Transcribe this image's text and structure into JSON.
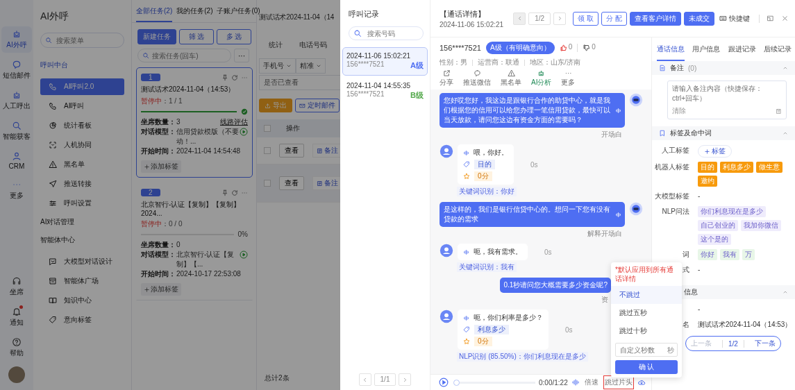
{
  "rail": {
    "items": [
      {
        "label": "AI外呼",
        "selected": true
      },
      {
        "label": "短信邮件",
        "selected": false
      },
      {
        "label": "人工呼出",
        "selected": false
      },
      {
        "label": "智能获客",
        "selected": false
      },
      {
        "label": "CRM",
        "selected": false
      },
      {
        "label": "更多",
        "selected": false
      }
    ],
    "bottom": [
      {
        "label": "坐席",
        "dot": false
      },
      {
        "label": "通知",
        "dot": true
      },
      {
        "label": "帮助",
        "dot": false
      }
    ]
  },
  "nav": {
    "title": "AI外呼",
    "search": {
      "placeholder": "搜索菜单"
    },
    "groups": [
      {
        "title": "呼叫中台",
        "items": [
          {
            "label": "AI呼叫2.0",
            "selected": true
          },
          {
            "label": "AI呼叫",
            "selected": false
          },
          {
            "label": "统计看板",
            "selected": false
          },
          {
            "label": "人机协同",
            "selected": false
          },
          {
            "label": "黑名单",
            "selected": false
          },
          {
            "label": "推送转接",
            "selected": false
          },
          {
            "label": "呼叫设置",
            "selected": false
          }
        ]
      },
      {
        "title": "AI对话管理"
      },
      {
        "title": "智能体中心",
        "items": [
          {
            "label": "大模型对话设计",
            "selected": false
          },
          {
            "label": "智能体广场",
            "selected": false
          },
          {
            "label": "知识中心",
            "selected": false
          },
          {
            "label": "意向标签",
            "selected": false
          }
        ]
      }
    ]
  },
  "tasks": {
    "tabs": [
      {
        "label": "全部任务(2)",
        "selected": true
      },
      {
        "label": "我的任务(2)",
        "selected": false
      },
      {
        "label": "子账户任务(0)",
        "selected": false
      }
    ],
    "buttons": [
      {
        "label": "新建任务",
        "kind": "primary"
      },
      {
        "label": "筛 选",
        "kind": "outline"
      },
      {
        "label": "多 选",
        "kind": "outline"
      }
    ],
    "search": {
      "placeholder": "搜索任务(回车)"
    },
    "more": "···",
    "cards": [
      {
        "number": "1",
        "title": "测试话术2024-11-04（14:53）",
        "status": "暂停中",
        "count": "：1 / 1",
        "level": 1,
        "complete": true,
        "selected": true,
        "fields": [
          {
            "label": "坐席数量：",
            "value": "3"
          },
          {
            "label": "对话模型：",
            "value": "信用贷款模版（不要动！..."
          },
          {
            "label": "开始时间：",
            "value": "2024-11-04 14:54:48"
          }
        ],
        "link": "线路评估",
        "add_tag": "添加标签"
      },
      {
        "number": "2",
        "title": "北京智行-认证【复制】【复制】2024...",
        "status": "暂停中",
        "count": "：0 / 0",
        "level": 0,
        "complete": false,
        "percent": "0%",
        "selected": false,
        "fields": [
          {
            "label": "坐席数量：",
            "value": "0"
          },
          {
            "label": "对话模型：",
            "value": "北京智行-认证【复制】【..."
          },
          {
            "label": "开始时间：",
            "value": "2024-10-17 22:53:08"
          }
        ],
        "add_tag": "添加标签"
      }
    ]
  },
  "main": {
    "title": "测试话术2024-11-04（14",
    "tabs": [
      "统计",
      "电话号码"
    ],
    "filters": [
      "手机号",
      "精准"
    ],
    "viewed_filter": {
      "placeholder": "是否已查看"
    },
    "buttons": [
      {
        "label": "导出",
        "kind": "warning"
      },
      {
        "label": "定时邮件",
        "kind": "outline"
      }
    ],
    "table": {
      "all_checked": false,
      "columns": [
        "操作"
      ],
      "rows": [
        {
          "actions": [
            "查看",
            "备注"
          ],
          "checked": false,
          "selected": false
        },
        {
          "actions": [
            "查看",
            "备注"
          ],
          "checked": false,
          "selected": true
        }
      ]
    },
    "total": "总计2条"
  },
  "records": {
    "title": "呼叫记录",
    "search": {
      "placeholder": "搜索号码"
    },
    "items": [
      {
        "time": "2024-11-06 15:02:21",
        "phone": "156****7521",
        "grade": "A级",
        "color": "#4e6ef2",
        "selected": true
      },
      {
        "time": "2024-11-04 14:55:35",
        "phone": "156****7521",
        "grade": "B级",
        "color": "#52a84a",
        "selected": false
      }
    ],
    "pager": "1/1"
  },
  "detail": {
    "title": "【通话详情】",
    "time": "2024-11-06 15:02:21",
    "pager": "1/2",
    "buttons": [
      {
        "label": "领 取",
        "kind": "outline"
      },
      {
        "label": "分 配",
        "kind": "outline"
      },
      {
        "label": "查看客户详情",
        "kind": "primary"
      },
      {
        "label": "未成交",
        "kind": "primary"
      }
    ],
    "shortcut": "快捷键",
    "phone": "156****7521",
    "intent": "A级（有明确意向）",
    "likes": "0",
    "dislikes": "0",
    "info": [
      "性别：男",
      "运营商：联通",
      "地区：山东/济南"
    ],
    "actions": [
      {
        "label": "分享",
        "selected": false
      },
      {
        "label": "推送微信",
        "selected": false
      },
      {
        "label": "黑名单",
        "selected": false
      },
      {
        "label": "AI分析",
        "selected": true
      },
      {
        "label": "更多",
        "selected": false
      }
    ],
    "messages": [
      {
        "kind": "robot",
        "text": "您好哎您好，我这边是跟银行合作的助贷中心，就是我们根据您的信用可以给您办理一笔信用贷款，最快可以当天放款，请问您这边有资金方面的需要吗？",
        "caption": "开场白"
      },
      {
        "kind": "user",
        "text": "喂，你好。",
        "tags": [
          "目的"
        ],
        "score": "0分",
        "time": "0s",
        "recognition": "关键词识别：你好"
      },
      {
        "kind": "robot",
        "text": "是这样的，我们是银行信贷中心的。想问一下您有没有贷款的需求",
        "caption": "解释开场白"
      },
      {
        "kind": "user",
        "text": "呃，我有需求。",
        "time": "0s",
        "recognition": "关键词识别：我有"
      },
      {
        "kind": "robot_cut",
        "text": "0.1秒请问您大概需要多少资金呢?",
        "caption": "资"
      },
      {
        "kind": "user",
        "text": "呃，你们利率是多少？",
        "tags": [
          "利息多少"
        ],
        "score": "0分",
        "time": "0s",
        "recognition": "NLP识别 (85.50%)：你们利息现在是多少"
      }
    ],
    "player": {
      "time": "0:00/1:22",
      "level": 0,
      "speed": "倍速",
      "skip_intro": "跳过片头",
      "highlighted": true
    },
    "skip_menu": {
      "note": "*默认应用到所有通话详情",
      "options": [
        {
          "label": "不跳过",
          "selected": true
        },
        {
          "label": "跳过五秒",
          "selected": false
        },
        {
          "label": "跳过十秒",
          "selected": false
        }
      ],
      "custom": {
        "placeholder": "自定义秒数",
        "unit": "秒"
      },
      "confirm": "确 认"
    }
  },
  "side": {
    "tabs": [
      {
        "label": "通话信息",
        "selected": true
      },
      {
        "label": "用户信息",
        "selected": false
      },
      {
        "label": "跟进记录",
        "selected": false
      },
      {
        "label": "后续记录",
        "selected": false
      }
    ],
    "note": {
      "title": "备注",
      "count": "(0)",
      "placeholder": "请输入备注内容（快捷保存：ctrl+回车）",
      "clear": "清除"
    },
    "tags": {
      "title": "标签及命中词",
      "rows": [
        {
          "label": "人工标签",
          "kind": "add",
          "button": "标签"
        },
        {
          "label": "机器人标签",
          "kind": "tags",
          "color": "#f79a0c",
          "values": [
            "目的",
            "利息多少",
            "做生意",
            "邀约"
          ]
        },
        {
          "label": "大模型标签",
          "kind": "text",
          "value": "-"
        },
        {
          "label": "NLP问法",
          "kind": "tags",
          "color": "#efecfc",
          "values": [
            "你们利息现在是多少",
            "自己创业的",
            "我加你微信",
            "这个是的"
          ]
        },
        {
          "label": "词",
          "kind": "tags",
          "color": "#e8f6e8",
          "values": [
            "你好",
            "我有",
            "万"
          ]
        },
        {
          "label": "式",
          "kind": "text",
          "value": "-"
        }
      ]
    },
    "info": {
      "title": "信息",
      "rows": [
        {
          "value": "-"
        },
        {
          "label": "名",
          "value": "测试话术2024-11-04（14:53）"
        }
      ]
    },
    "pager": {
      "prev": "上一条",
      "page": "1/2",
      "next": "下一条",
      "prev_disabled": true
    }
  }
}
